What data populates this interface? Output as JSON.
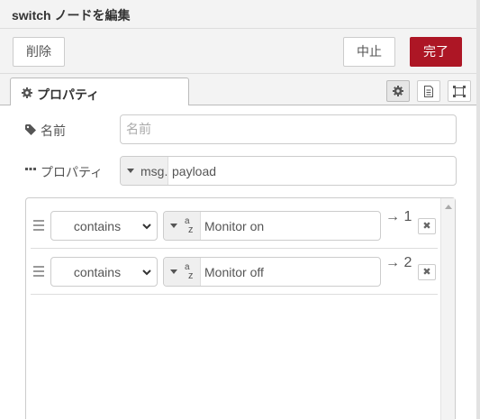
{
  "header": {
    "title": "switch ノードを編集"
  },
  "toolbar": {
    "delete_label": "削除",
    "cancel_label": "中止",
    "done_label": "完了"
  },
  "tabs": {
    "active_label": "プロパティ",
    "icons": [
      "gear-icon",
      "document-icon",
      "layout-icon"
    ]
  },
  "form": {
    "name_label": "名前",
    "name_placeholder": "名前",
    "property_label": "プロパティ",
    "property_type": "msg.",
    "property_value": "payload"
  },
  "rules": [
    {
      "operator": "contains",
      "value": "Monitor on",
      "output": "→ 1"
    },
    {
      "operator": "contains",
      "value": "Monitor off",
      "output": "→ 2"
    }
  ],
  "colors": {
    "done_button": "#ad1625",
    "header_bg": "#f3f3f3"
  }
}
